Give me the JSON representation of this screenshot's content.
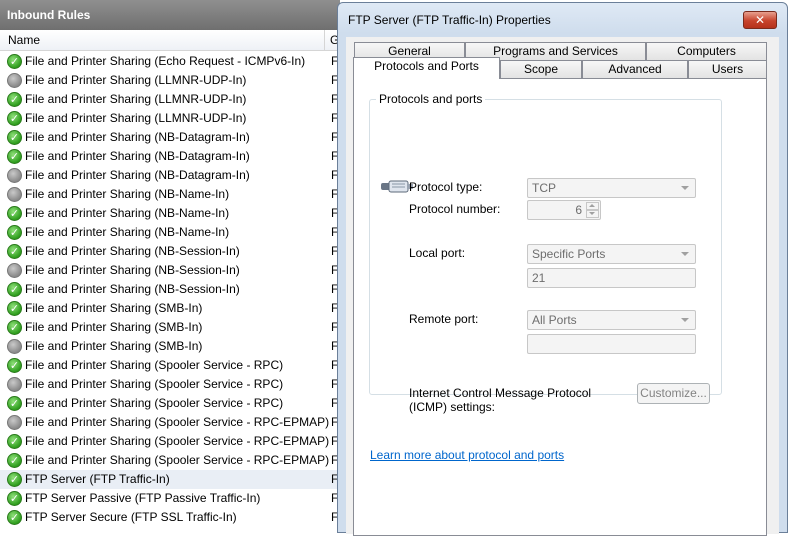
{
  "left_pane": {
    "title": "Inbound Rules",
    "columns": {
      "name": "Name",
      "group": "G"
    },
    "rules": [
      {
        "name": "File and Printer Sharing (Echo Request - ICMPv6-In)",
        "group": "F",
        "enabled": true
      },
      {
        "name": "File and Printer Sharing (LLMNR-UDP-In)",
        "group": "F",
        "enabled": false
      },
      {
        "name": "File and Printer Sharing (LLMNR-UDP-In)",
        "group": "F",
        "enabled": true
      },
      {
        "name": "File and Printer Sharing (LLMNR-UDP-In)",
        "group": "F",
        "enabled": true
      },
      {
        "name": "File and Printer Sharing (NB-Datagram-In)",
        "group": "F",
        "enabled": true
      },
      {
        "name": "File and Printer Sharing (NB-Datagram-In)",
        "group": "F",
        "enabled": true
      },
      {
        "name": "File and Printer Sharing (NB-Datagram-In)",
        "group": "F",
        "enabled": false
      },
      {
        "name": "File and Printer Sharing (NB-Name-In)",
        "group": "F",
        "enabled": false
      },
      {
        "name": "File and Printer Sharing (NB-Name-In)",
        "group": "F",
        "enabled": true
      },
      {
        "name": "File and Printer Sharing (NB-Name-In)",
        "group": "F",
        "enabled": true
      },
      {
        "name": "File and Printer Sharing (NB-Session-In)",
        "group": "F",
        "enabled": true
      },
      {
        "name": "File and Printer Sharing (NB-Session-In)",
        "group": "F",
        "enabled": false
      },
      {
        "name": "File and Printer Sharing (NB-Session-In)",
        "group": "F",
        "enabled": true
      },
      {
        "name": "File and Printer Sharing (SMB-In)",
        "group": "F",
        "enabled": true
      },
      {
        "name": "File and Printer Sharing (SMB-In)",
        "group": "F",
        "enabled": true
      },
      {
        "name": "File and Printer Sharing (SMB-In)",
        "group": "F",
        "enabled": false
      },
      {
        "name": "File and Printer Sharing (Spooler Service - RPC)",
        "group": "F",
        "enabled": true
      },
      {
        "name": "File and Printer Sharing (Spooler Service - RPC)",
        "group": "F",
        "enabled": false
      },
      {
        "name": "File and Printer Sharing (Spooler Service - RPC)",
        "group": "F",
        "enabled": true
      },
      {
        "name": "File and Printer Sharing (Spooler Service - RPC-EPMAP)",
        "group": "F",
        "enabled": false
      },
      {
        "name": "File and Printer Sharing (Spooler Service - RPC-EPMAP)",
        "group": "F",
        "enabled": true
      },
      {
        "name": "File and Printer Sharing (Spooler Service - RPC-EPMAP)",
        "group": "F",
        "enabled": true
      },
      {
        "name": "FTP Server (FTP Traffic-In)",
        "group": "F",
        "enabled": true,
        "selected": true
      },
      {
        "name": "FTP Server Passive (FTP Passive Traffic-In)",
        "group": "F",
        "enabled": true
      },
      {
        "name": "FTP Server Secure (FTP SSL Traffic-In)",
        "group": "F",
        "enabled": true
      }
    ]
  },
  "dialog": {
    "title": "FTP Server (FTP Traffic-In) Properties",
    "close_label": "✕",
    "tabs_row1": [
      "General",
      "Programs and Services",
      "Computers"
    ],
    "tabs_row2": [
      "Protocols and Ports",
      "Scope",
      "Advanced",
      "Users"
    ],
    "active_tab": "Protocols and Ports",
    "groupbox_title": "Protocols and ports",
    "protocol_type_label": "Protocol type:",
    "protocol_type_value": "TCP",
    "protocol_number_label": "Protocol number:",
    "protocol_number_value": "6",
    "local_port_label": "Local port:",
    "local_port_value": "Specific Ports",
    "local_port_text": "21",
    "remote_port_label": "Remote port:",
    "remote_port_value": "All Ports",
    "remote_port_text": "",
    "icmp_label_line1": "Internet Control Message Protocol",
    "icmp_label_line2": "(ICMP) settings:",
    "customize_label": "Customize...",
    "learn_more_link": "Learn more about protocol and ports"
  }
}
